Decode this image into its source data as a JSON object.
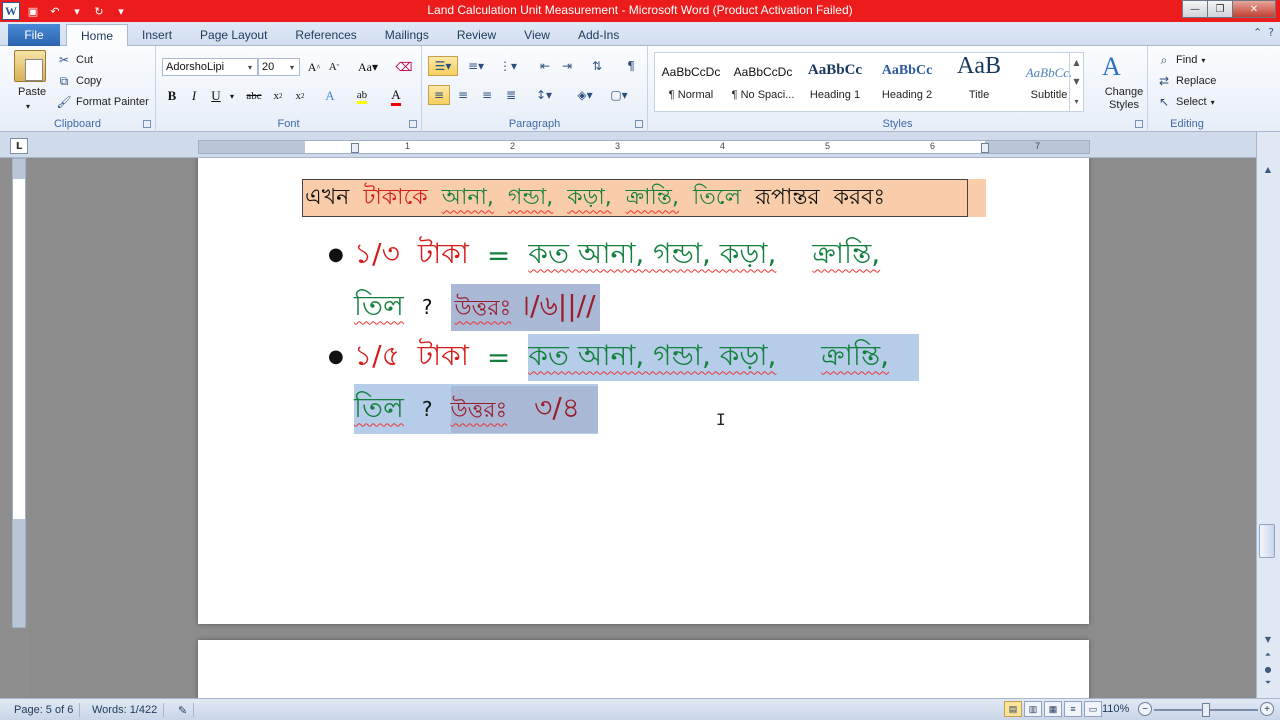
{
  "window": {
    "title": "Land Calculation Unit Measurement  -  Microsoft Word (Product Activation Failed)",
    "app_icon": "W"
  },
  "tabs": {
    "file": "File",
    "items": [
      "Home",
      "Insert",
      "Page Layout",
      "References",
      "Mailings",
      "Review",
      "View",
      "Add-Ins"
    ]
  },
  "clipboard": {
    "paste": "Paste",
    "cut": "Cut",
    "copy": "Copy",
    "format_painter": "Format Painter",
    "label": "Clipboard"
  },
  "font": {
    "name": "AdorshoLipi",
    "size": "20",
    "label": "Font"
  },
  "paragraph": {
    "label": "Paragraph"
  },
  "styles": {
    "label": "Styles",
    "change_styles": "Change Styles",
    "tiles": [
      {
        "sample": "AaBbCcDc",
        "name": "¶ Normal"
      },
      {
        "sample": "AaBbCcDc",
        "name": "¶ No Spaci..."
      },
      {
        "sample": "AaBbCc",
        "name": "Heading 1"
      },
      {
        "sample": "AaBbCc",
        "name": "Heading 2"
      },
      {
        "sample": "AaB",
        "name": "Title"
      },
      {
        "sample": "AaBbCc.",
        "name": "Subtitle"
      }
    ]
  },
  "editing": {
    "label": "Editing",
    "find": "Find",
    "replace": "Replace",
    "select": "Select"
  },
  "ruler": {
    "numbers": [
      "1",
      "2",
      "3",
      "4",
      "5",
      "6",
      "7"
    ]
  },
  "document": {
    "headline": [
      "এখন",
      "টাকাকে",
      "আনা,",
      "গন্ডা,",
      "কড়া,",
      "ক্রান্তি,",
      "তিলে",
      "রূপান্তর",
      "করবঃ"
    ],
    "item1_line1": {
      "fraction": "১/৩",
      "unit": "টাকা",
      "eq": "=",
      "words": "কত আনা, গন্ডা, কড়া,",
      "kranti": "ক্রান্তি,"
    },
    "item1_line2": {
      "til": "তিল",
      "q": "?",
      "answer_label": "উত্তরঃ",
      "answer": "।/৬||//"
    },
    "item2_line1": {
      "fraction": "১/৫",
      "unit": "টাকা",
      "eq": "=",
      "words": "কত আনা, গন্ডা, কড়া,",
      "kranti": "ক্রান্তি,"
    },
    "item2_line2": {
      "til": "তিল",
      "q": "?",
      "answer_label": "উত্তরঃ",
      "answer": "৩/৪"
    }
  },
  "status": {
    "page": "Page: 5 of 6",
    "words": "Words: 1/422",
    "zoom": "110%"
  }
}
